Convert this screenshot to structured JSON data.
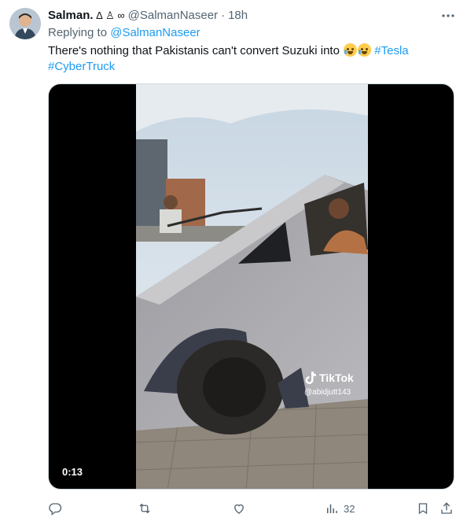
{
  "tweet": {
    "author_name": "Salman.",
    "author_badges": "∆ ♙ ∞",
    "handle": "@SalmanNaseer",
    "separator": "·",
    "time": "18h",
    "replying_prefix": "Replying to",
    "replying_to": "@SalmanNaseer",
    "text_main": "There's nothing that Pakistanis can't convert Suzuki into",
    "hashtags": [
      "#Tesla",
      "#CyberTruck"
    ],
    "emojis": [
      "loudly-crying-face",
      "face-with-tears-of-joy"
    ]
  },
  "media": {
    "duration": "0:13",
    "watermark_title": "TikTok",
    "watermark_user": "@abidjutt143"
  },
  "actions": {
    "reply_count": "",
    "retweet_count": "",
    "like_count": "",
    "views_count": "32"
  },
  "colors": {
    "accent": "#1d9bf0",
    "secondary_text": "#536471",
    "primary_text": "#0f1419"
  },
  "icons": [
    "more-icon",
    "reply-icon",
    "retweet-icon",
    "like-icon",
    "views-icon",
    "bookmark-icon",
    "share-icon",
    "tiktok-logo-icon"
  ]
}
